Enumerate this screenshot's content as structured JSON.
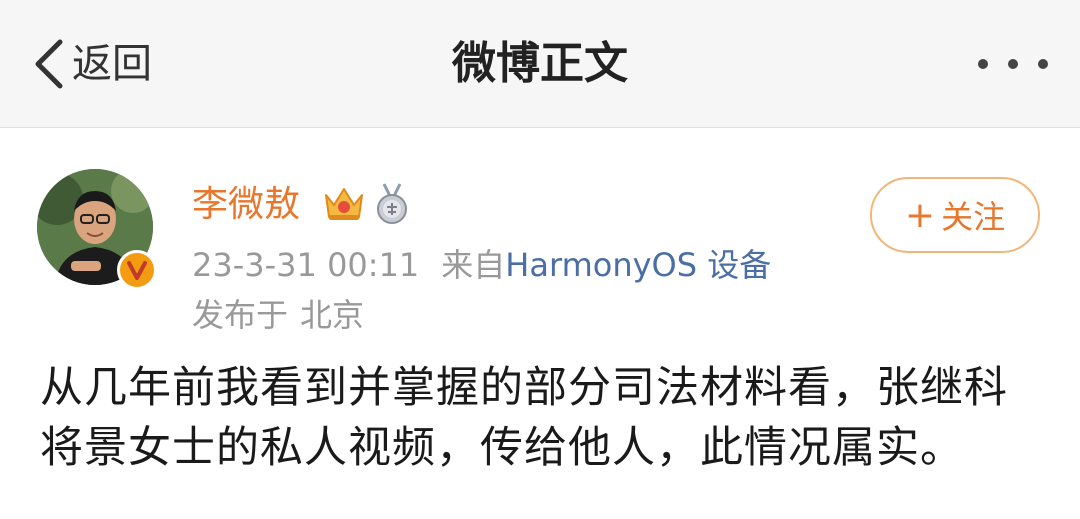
{
  "navbar": {
    "back_label": "返回",
    "title": "微博正文",
    "more_icon": "more-dots-icon"
  },
  "post": {
    "author": "李微敖",
    "badges": [
      "crown-icon",
      "medal-icon"
    ],
    "verified_icon": "verified-v-icon",
    "timestamp": "23-3-31 00:11",
    "source_prefix": "来自",
    "source": "HarmonyOS 设备",
    "location_prefix": "发布于",
    "location": "北京",
    "follow_label": "关注",
    "content_lines": [
      "从几年前我看到并掌握的部分司法材料看，张继科",
      "将景女士的私人视频，传给他人，此情况属实。"
    ]
  },
  "colors": {
    "accent": "#e8762b",
    "link": "#4a6ea5",
    "muted": "#999999",
    "navbar_bg": "#f6f6f6"
  }
}
